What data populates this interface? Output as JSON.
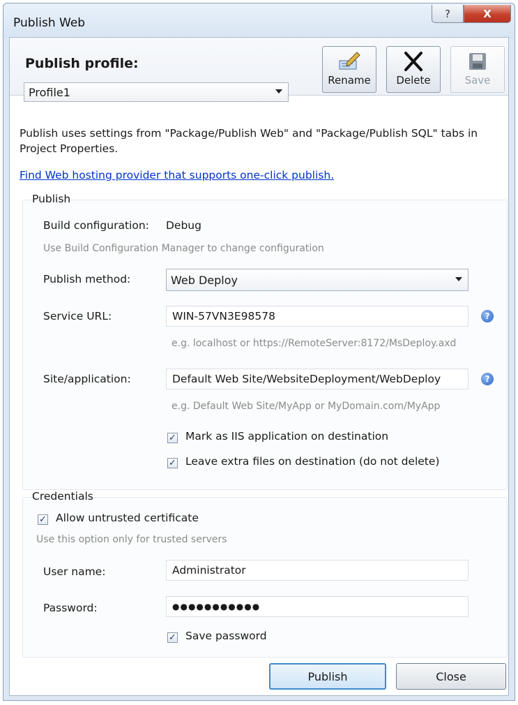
{
  "window": {
    "title": "Publish Web",
    "help_glyph": "?",
    "close_glyph": "X"
  },
  "profile": {
    "heading": "Publish profile:",
    "selected": "Profile1",
    "buttons": {
      "rename": "Rename",
      "delete": "Delete",
      "save": "Save"
    }
  },
  "info": {
    "description": "Publish uses settings from \"Package/Publish Web\" and \"Package/Publish SQL\" tabs in Project Properties.",
    "link": "Find Web hosting provider that supports one-click publish."
  },
  "publish": {
    "group_title": "Publish",
    "build_config_label": "Build configuration:",
    "build_config_value": "Debug",
    "build_hint": "Use Build Configuration Manager to change configuration",
    "method_label": "Publish method:",
    "method_value": "Web Deploy",
    "service_url_label": "Service URL:",
    "service_url_value": "WIN-57VN3E98578",
    "service_url_hint": "e.g. localhost or https://RemoteServer:8172/MsDeploy.axd",
    "site_label": "Site/application:",
    "site_value": "Default Web Site/WebsiteDeployment/WebDeploy",
    "site_hint": "e.g. Default Web Site/MyApp or MyDomain.com/MyApp",
    "mark_iis_label": "Mark as IIS application on destination",
    "mark_iis_checked": true,
    "leave_files_label": "Leave extra files on destination (do not delete)",
    "leave_files_checked": true
  },
  "credentials": {
    "group_title": "Credentials",
    "allow_untrusted_label": "Allow untrusted certificate",
    "allow_untrusted_checked": true,
    "trusted_hint": "Use this option only for trusted servers",
    "username_label": "User name:",
    "username_value": "Administrator",
    "password_label": "Password:",
    "password_value": "●●●●●●●●●●●",
    "save_password_label": "Save password",
    "save_password_checked": true
  },
  "actions": {
    "publish": "Publish",
    "close": "Close"
  },
  "icons": {
    "help": "help-icon",
    "check": "✓"
  }
}
